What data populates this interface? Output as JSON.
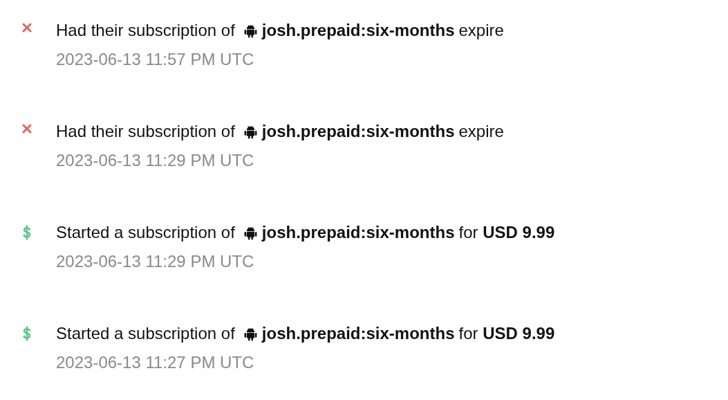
{
  "events": [
    {
      "kind": "expire",
      "prefix": "Had their subscription of",
      "product": "josh.prepaid:six-months",
      "suffix": "expire",
      "time": "2023-06-13 11:57 PM UTC"
    },
    {
      "kind": "expire",
      "prefix": "Had their subscription of",
      "product": "josh.prepaid:six-months",
      "suffix": "expire",
      "time": "2023-06-13 11:29 PM UTC"
    },
    {
      "kind": "purchase",
      "prefix": "Started a subscription of",
      "product": "josh.prepaid:six-months",
      "suffix": "for **USD 9.99**",
      "time": "2023-06-13 11:29 PM UTC"
    },
    {
      "kind": "purchase",
      "prefix": "Started a subscription of",
      "product": "josh.prepaid:six-months",
      "suffix": "for **USD 9.99**",
      "time": "2023-06-13 11:27 PM UTC"
    }
  ]
}
